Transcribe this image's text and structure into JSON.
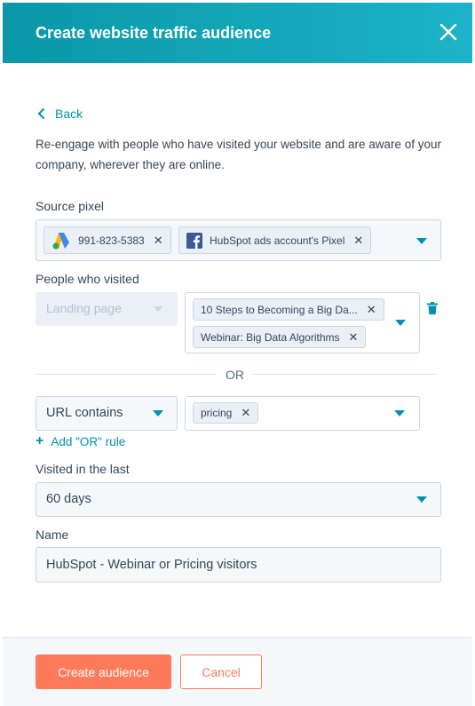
{
  "header": {
    "title": "Create website traffic audience",
    "close_icon": "close-icon"
  },
  "back": {
    "label": "Back"
  },
  "description": "Re-engage with people who have visited your website and are aware of your company, wherever they are online.",
  "source_pixel": {
    "label": "Source pixel",
    "tags": [
      {
        "icon": "google-ads-icon",
        "label": "991-823-5383"
      },
      {
        "icon": "facebook-icon",
        "label": "HubSpot ads account's Pixel"
      }
    ]
  },
  "people_visited": {
    "label": "People who visited",
    "type_select": "Landing page",
    "pages": [
      "10 Steps to Becoming a Big Da...",
      "Webinar: Big Data Algorithms"
    ]
  },
  "or_label": "OR",
  "url_rule": {
    "type_select": "URL contains",
    "tags": [
      "pricing"
    ]
  },
  "add_or_rule": "Add \"OR\" rule",
  "visited_last": {
    "label": "Visited in the last",
    "value": "60 days"
  },
  "name": {
    "label": "Name",
    "value": "HubSpot - Webinar or Pricing visitors"
  },
  "footer": {
    "primary": "Create audience",
    "secondary": "Cancel"
  },
  "colors": {
    "header": "#0a97a8",
    "accent": "#0091ae",
    "primary_button": "#ff7a59"
  }
}
